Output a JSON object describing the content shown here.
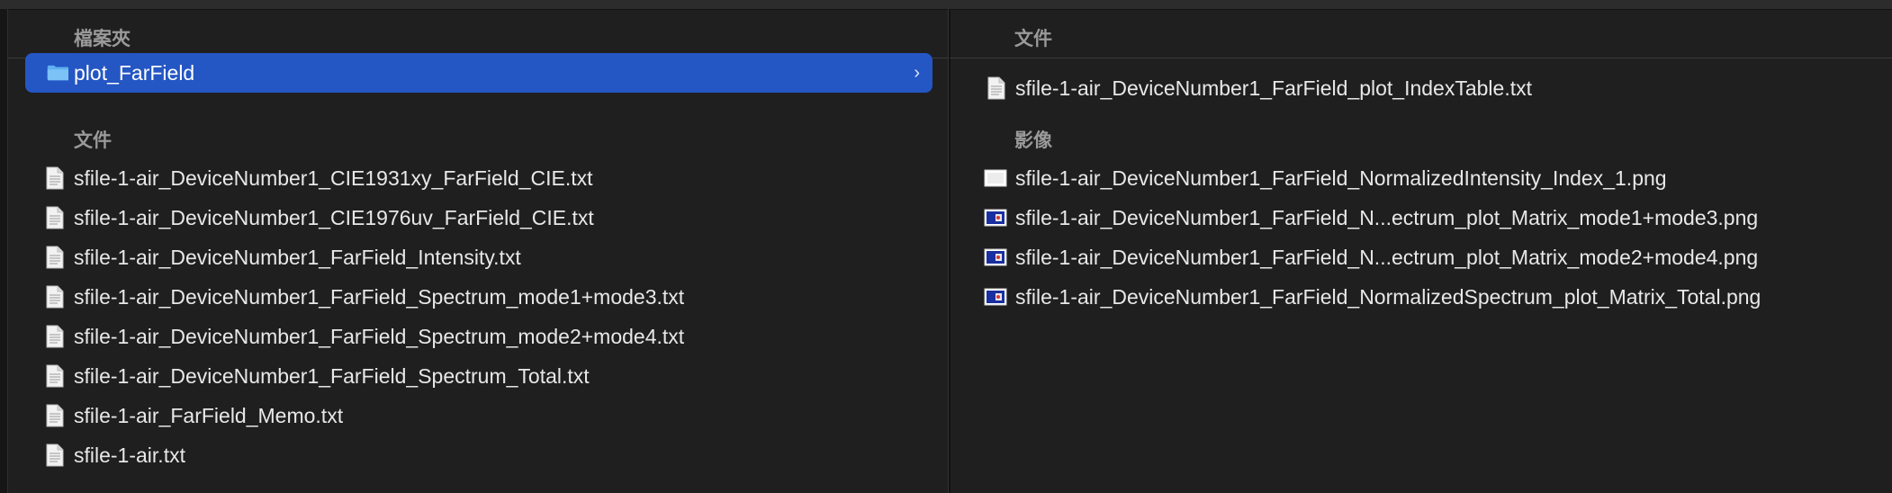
{
  "left_column": {
    "header": "檔案夾",
    "selected_folder": "plot_FarField",
    "files_section_label": "文件",
    "files": [
      "sfile-1-air_DeviceNumber1_CIE1931xy_FarField_CIE.txt",
      "sfile-1-air_DeviceNumber1_CIE1976uv_FarField_CIE.txt",
      "sfile-1-air_DeviceNumber1_FarField_Intensity.txt",
      "sfile-1-air_DeviceNumber1_FarField_Spectrum_mode1+mode3.txt",
      "sfile-1-air_DeviceNumber1_FarField_Spectrum_mode2+mode4.txt",
      "sfile-1-air_DeviceNumber1_FarField_Spectrum_Total.txt",
      "sfile-1-air_FarField_Memo.txt",
      "sfile-1-air.txt"
    ]
  },
  "right_column": {
    "header": "文件",
    "documents": [
      "sfile-1-air_DeviceNumber1_FarField_plot_IndexTable.txt"
    ],
    "images_section_label": "影像",
    "images": [
      {
        "name": "sfile-1-air_DeviceNumber1_FarField_NormalizedIntensity_Index_1.png",
        "thumb": "plain"
      },
      {
        "name": "sfile-1-air_DeviceNumber1_FarField_N...ectrum_plot_Matrix_mode1+mode3.png",
        "thumb": "plot"
      },
      {
        "name": "sfile-1-air_DeviceNumber1_FarField_N...ectrum_plot_Matrix_mode2+mode4.png",
        "thumb": "plot"
      },
      {
        "name": "sfile-1-air_DeviceNumber1_FarField_NormalizedSpectrum_plot_Matrix_Total.png",
        "thumb": "plot"
      }
    ]
  },
  "colors": {
    "selection": "#2456c4",
    "background": "#1f1f1f",
    "section_label": "#9a9a9a"
  },
  "icons": {
    "folder": "folder-icon",
    "document": "document-icon",
    "image": "image-icon",
    "chevron": "chevron-right-icon"
  }
}
